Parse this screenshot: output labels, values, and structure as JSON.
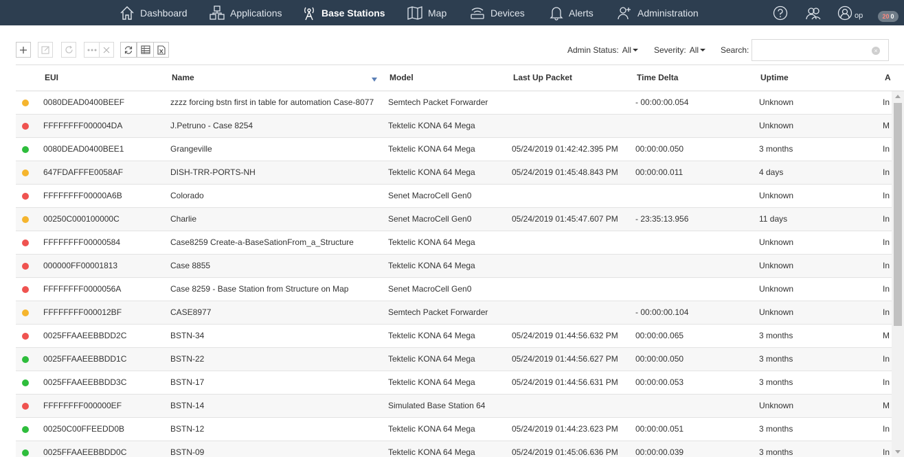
{
  "nav": {
    "items": [
      {
        "label": "Dashboard",
        "icon": "home-icon"
      },
      {
        "label": "Applications",
        "icon": "applications-icon"
      },
      {
        "label": "Base Stations",
        "icon": "base-station-icon",
        "active": true
      },
      {
        "label": "Map",
        "icon": "map-icon"
      },
      {
        "label": "Devices",
        "icon": "devices-icon"
      },
      {
        "label": "Alerts",
        "icon": "bell-icon"
      },
      {
        "label": "Administration",
        "icon": "add-user-icon"
      }
    ],
    "user": "op",
    "notifications": {
      "critical": "20",
      "other": "0"
    }
  },
  "toolbar": {
    "admin_status_label": "Admin Status:",
    "admin_status_value": "All",
    "severity_label": "Severity:",
    "severity_value": "All",
    "search_label": "Search:",
    "search_value": ""
  },
  "table": {
    "columns": [
      "EUI",
      "Name",
      "Model",
      "Last Up Packet",
      "Time Delta",
      "Uptime",
      "A"
    ],
    "sort_column": "Name",
    "status_colors": {
      "warning": "#f5b52e",
      "down": "#ef5350",
      "up": "#2ebd3c"
    },
    "rows": [
      {
        "status": "warning",
        "eui": "0080DEAD0400BEEF",
        "name": "zzzz forcing bstn first in table for automation Case-8077",
        "model": "Semtech Packet Forwarder",
        "last_up": "",
        "delta": "- 00:00:00.054",
        "uptime": "Unknown",
        "admin": "In"
      },
      {
        "status": "down",
        "eui": "FFFFFFFF000004DA",
        "name": "J.Petruno - Case 8254",
        "model": "Tektelic KONA 64 Mega",
        "last_up": "",
        "delta": "",
        "uptime": "Unknown",
        "admin": "M"
      },
      {
        "status": "up",
        "eui": "0080DEAD0400BEE1",
        "name": "Grangeville",
        "model": "Tektelic KONA 64 Mega",
        "last_up": "05/24/2019 01:42:42.395 PM",
        "delta": "00:00:00.050",
        "uptime": "3 months",
        "admin": "In"
      },
      {
        "status": "warning",
        "eui": "647FDAFFFE0058AF",
        "name": "DISH-TRR-PORTS-NH",
        "model": "Tektelic KONA 64 Mega",
        "last_up": "05/24/2019 01:45:48.843 PM",
        "delta": "00:00:00.011",
        "uptime": "4 days",
        "admin": "In"
      },
      {
        "status": "down",
        "eui": "FFFFFFFF00000A6B",
        "name": "Colorado",
        "model": "Senet MacroCell Gen0",
        "last_up": "",
        "delta": "",
        "uptime": "Unknown",
        "admin": "In"
      },
      {
        "status": "warning",
        "eui": "00250C000100000C",
        "name": "Charlie",
        "model": "Senet MacroCell Gen0",
        "last_up": "05/24/2019 01:45:47.607 PM",
        "delta": "- 23:35:13.956",
        "uptime": "11 days",
        "admin": "In"
      },
      {
        "status": "down",
        "eui": "FFFFFFFF00000584",
        "name": "Case8259 Create-a-BaseSationFrom_a_Structure",
        "model": "Tektelic KONA 64 Mega",
        "last_up": "",
        "delta": "",
        "uptime": "Unknown",
        "admin": "In"
      },
      {
        "status": "down",
        "eui": "000000FF00001813",
        "name": "Case 8855",
        "model": "Tektelic KONA 64 Mega",
        "last_up": "",
        "delta": "",
        "uptime": "Unknown",
        "admin": "In"
      },
      {
        "status": "down",
        "eui": "FFFFFFFF0000056A",
        "name": "Case 8259 - Base Station from Structure on Map",
        "model": "Senet MacroCell Gen0",
        "last_up": "",
        "delta": "",
        "uptime": "Unknown",
        "admin": "In"
      },
      {
        "status": "warning",
        "eui": "FFFFFFFF000012BF",
        "name": "CASE8977",
        "model": "Semtech Packet Forwarder",
        "last_up": "",
        "delta": "- 00:00:00.104",
        "uptime": "Unknown",
        "admin": "In"
      },
      {
        "status": "down",
        "eui": "0025FFAAEEBBDD2C",
        "name": "BSTN-34",
        "model": "Tektelic KONA 64 Mega",
        "last_up": "05/24/2019 01:44:56.632 PM",
        "delta": "00:00:00.065",
        "uptime": "3 months",
        "admin": "M"
      },
      {
        "status": "up",
        "eui": "0025FFAAEEBBDD1C",
        "name": "BSTN-22",
        "model": "Tektelic KONA 64 Mega",
        "last_up": "05/24/2019 01:44:56.627 PM",
        "delta": "00:00:00.050",
        "uptime": "3 months",
        "admin": "In"
      },
      {
        "status": "up",
        "eui": "0025FFAAEEBBDD3C",
        "name": "BSTN-17",
        "model": "Tektelic KONA 64 Mega",
        "last_up": "05/24/2019 01:44:56.631 PM",
        "delta": "00:00:00.053",
        "uptime": "3 months",
        "admin": "In"
      },
      {
        "status": "down",
        "eui": "FFFFFFFF000000EF",
        "name": "BSTN-14",
        "model": "Simulated Base Station 64",
        "last_up": "",
        "delta": "",
        "uptime": "Unknown",
        "admin": "M"
      },
      {
        "status": "up",
        "eui": "00250C00FFEEDD0B",
        "name": "BSTN-12",
        "model": "Tektelic KONA 64 Mega",
        "last_up": "05/24/2019 01:44:23.623 PM",
        "delta": "00:00:00.051",
        "uptime": "3 months",
        "admin": "In"
      },
      {
        "status": "up",
        "eui": "0025FFAAEEBBDD0C",
        "name": "BSTN-09",
        "model": "Tektelic KONA 64 Mega",
        "last_up": "05/24/2019 01:45:06.636 PM",
        "delta": "00:00:00.039",
        "uptime": "3 months",
        "admin": "In"
      }
    ]
  }
}
